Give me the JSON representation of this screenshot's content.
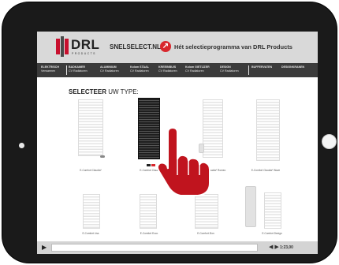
{
  "header": {
    "logo_text": "DRL",
    "logo_sub": "PRODUCTS",
    "site_name": "SNELSELECT.NL",
    "tagline": "Hét selectieprogramma van DRL Products",
    "accent_color": "#d8272d"
  },
  "nav": {
    "items": [
      {
        "line1": "ELEKTRISCH",
        "line2": "Verwarmen"
      },
      {
        "line1": "BADKAMER",
        "line2": "CV Radiatoren"
      },
      {
        "line1": "ALUMINIUM",
        "line2": "CV Radiatoren"
      },
      {
        "line1": "Kolom STAAL",
        "line2": "CV Radiatoren"
      },
      {
        "line1": "KREEINBUIS",
        "line2": "CV Radiatoren"
      },
      {
        "line1": "Kolom GIETIJZER",
        "line2": "CV Radiatoren"
      },
      {
        "line1": "DESIGN",
        "line2": "CV Radiatoren"
      },
      {
        "line1": "BUFFERVATEN",
        "line2": ""
      },
      {
        "line1": "DESIGNKRANEN",
        "line2": ""
      }
    ]
  },
  "content": {
    "title_bold": "SELECTEER",
    "title_rest": " UW TYPE:",
    "products": [
      {
        "name": "E-Comfort Claudia*"
      },
      {
        "name": "E-Comfort Claudia* Bl"
      },
      {
        "name": "E-Comfort Claudia* Romeo"
      },
      {
        "name": "E-Comfort Claudia* Wave"
      },
      {
        "name": "E-Comfort Liss"
      },
      {
        "name": "E-Comfort Ecco"
      },
      {
        "name": "E-Comfort Zion"
      },
      {
        "name": "E-Comfort Design"
      }
    ]
  },
  "player": {
    "play_icon": "play-icon",
    "volume_icon": "speaker-icon",
    "time": "1:23,00",
    "progress": 0.0
  }
}
